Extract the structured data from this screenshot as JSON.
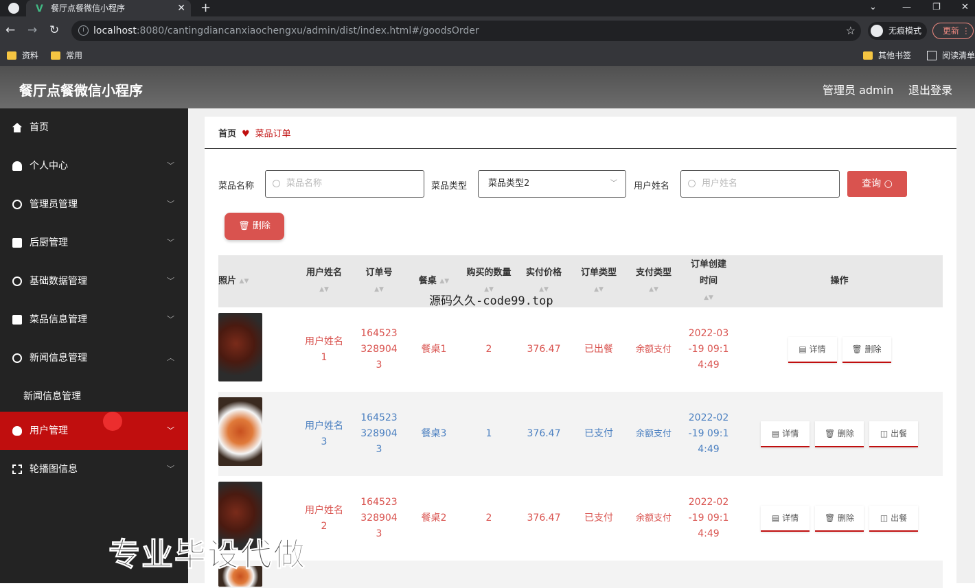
{
  "browser": {
    "tab_title": "餐厅点餐微信小程序",
    "url_host": "localhost",
    "url_rest": ":8080/cantingdiancanxiaochengxu/admin/dist/index.html#/goodsOrder",
    "incognito_label": "无痕模式",
    "update_label": "更新",
    "bookmarks": [
      "资料",
      "常用"
    ],
    "bookmarks_right": [
      "其他书签",
      "阅读清单"
    ]
  },
  "header": {
    "brand": "餐厅点餐微信小程序",
    "admin": "管理员 admin",
    "logout": "退出登录"
  },
  "sidebar": {
    "items": [
      {
        "label": "首页",
        "icon": "home-icon"
      },
      {
        "label": "个人中心",
        "icon": "user-icon"
      },
      {
        "label": "管理员管理",
        "icon": "clock-icon"
      },
      {
        "label": "后厨管理",
        "icon": "briefcase-icon"
      },
      {
        "label": "基础数据管理",
        "icon": "gauge-icon"
      },
      {
        "label": "菜品信息管理",
        "icon": "monitor-icon"
      },
      {
        "label": "新闻信息管理",
        "icon": "settings-icon"
      },
      {
        "label": "新闻信息管理",
        "icon": ""
      },
      {
        "label": "用户管理",
        "icon": "bulb-icon"
      },
      {
        "label": "轮播图信息",
        "icon": "fullscreen-icon"
      }
    ]
  },
  "breadcrumb": {
    "home": "首页",
    "current": "菜品订单"
  },
  "filters": {
    "name_label": "菜品名称",
    "name_placeholder": "菜品名称",
    "type_label": "菜品类型",
    "type_value": "菜品类型2",
    "user_label": "用户姓名",
    "user_placeholder": "用户姓名",
    "query_label": "查询",
    "delete_label": "删除"
  },
  "table": {
    "headers": [
      "照片",
      "用户姓名",
      "订单号",
      "餐桌",
      "购买的数量",
      "实付价格",
      "订单类型",
      "支付类型",
      "订单创建时间",
      "操作"
    ],
    "rows": [
      {
        "user": "用户姓名1",
        "order_no": "1645233289043",
        "table": "餐桌1",
        "qty": "2",
        "price": "376.47",
        "order_type": "已出餐",
        "pay_type": "余额支付",
        "created": "2022-03-19 09:14:49",
        "color": "red",
        "ops": [
          "详情",
          "删除"
        ]
      },
      {
        "user": "用户姓名3",
        "order_no": "1645233289043",
        "table": "餐桌3",
        "qty": "1",
        "price": "376.47",
        "order_type": "已支付",
        "pay_type": "余额支付",
        "created": "2022-02-19 09:14:49",
        "color": "blue",
        "ops": [
          "详情",
          "删除",
          "出餐"
        ]
      },
      {
        "user": "用户姓名2",
        "order_no": "1645233289043",
        "table": "餐桌2",
        "qty": "2",
        "price": "376.47",
        "order_type": "已支付",
        "pay_type": "余额支付",
        "created": "2022-02-19 09:14:49",
        "color": "red",
        "ops": [
          "详情",
          "删除",
          "出餐"
        ]
      }
    ]
  },
  "overlay": {
    "watermark_center": "源码久久-code99.top",
    "watermark_bottom": "专业毕设代做"
  }
}
